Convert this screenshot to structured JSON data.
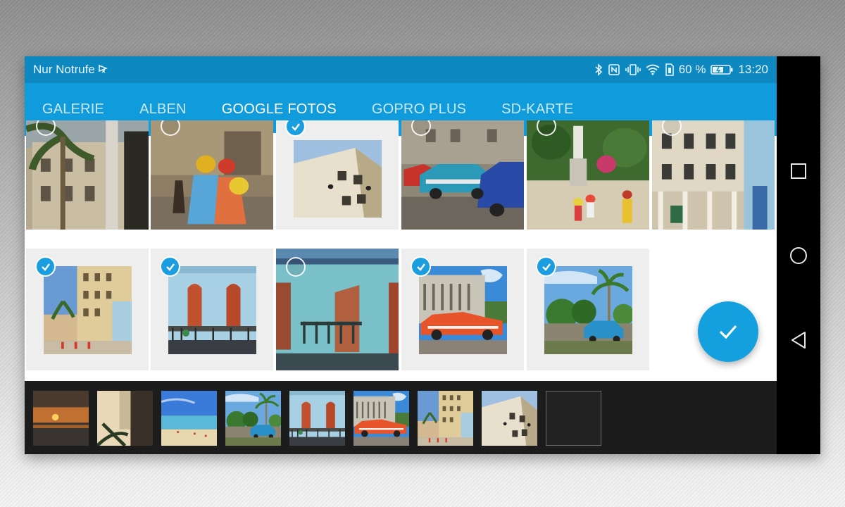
{
  "status_bar": {
    "carrier": "Nur Notrufe",
    "battery_percent": "60 %",
    "time": "13:20",
    "icons": [
      "bluetooth-icon",
      "nfc-icon",
      "vibrate-icon",
      "wifi-icon",
      "sim-icon",
      "battery-icon"
    ]
  },
  "tabs": [
    {
      "label": "GALERIE",
      "active": false
    },
    {
      "label": "ALBEN",
      "active": false
    },
    {
      "label": "GOOGLE FOTOS",
      "active": true
    },
    {
      "label": "GOPRO PLUS",
      "active": false
    },
    {
      "label": "SD-KARTE",
      "active": false
    }
  ],
  "grid": {
    "photos": [
      {
        "subject": "havana-building-palm",
        "selected": false
      },
      {
        "subject": "street-dancers",
        "selected": false
      },
      {
        "subject": "white-building-climbers",
        "selected": true
      },
      {
        "subject": "classic-cars-street",
        "selected": false
      },
      {
        "subject": "statue-plaza",
        "selected": false
      },
      {
        "subject": "colonial-facade",
        "selected": false
      },
      {
        "subject": "yellow-building-street",
        "selected": true
      },
      {
        "subject": "blue-house-red-doors",
        "selected": true
      },
      {
        "subject": "turquoise-house-balcony",
        "selected": false
      },
      {
        "subject": "orange-classic-car",
        "selected": true
      },
      {
        "subject": "blue-car-palm-trees",
        "selected": true
      }
    ]
  },
  "fab": {
    "icon": "check-icon"
  },
  "tray": {
    "thumbnails": [
      "sunset-sea",
      "palm-window",
      "beach",
      "blue-car-palm",
      "blue-house",
      "orange-car",
      "yellow-building",
      "white-building-climbers"
    ],
    "empty_slots": 1
  },
  "colors": {
    "status_bar": "#0d88c0",
    "tab_bar": "#109bdd",
    "accent": "#1a9ee0",
    "tray": "#1c1c1c"
  },
  "nav_buttons": [
    "recent-apps-icon",
    "home-icon",
    "back-icon"
  ]
}
